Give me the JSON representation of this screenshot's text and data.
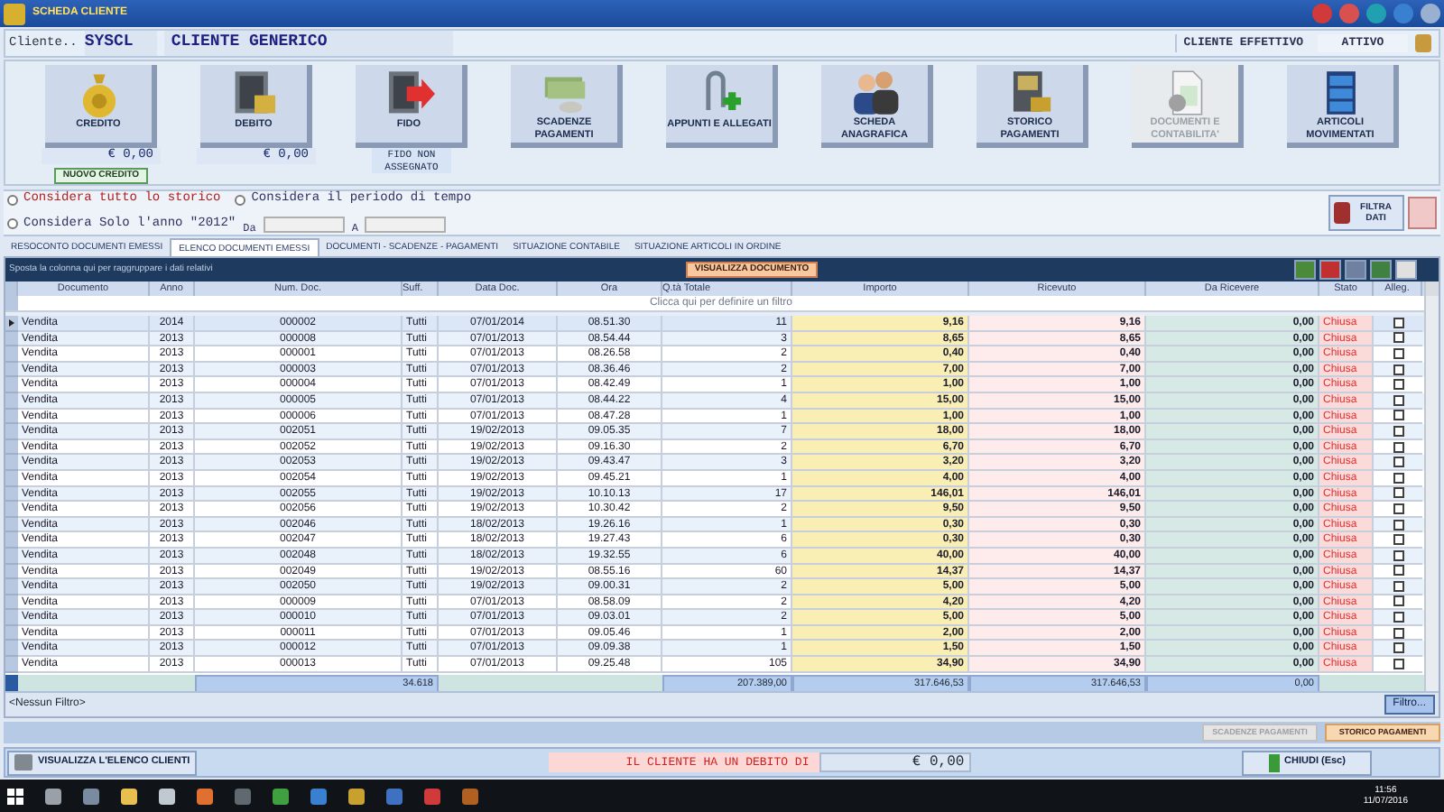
{
  "window": {
    "title": "SCHEDA CLIENTE"
  },
  "client_bar": {
    "label": "Cliente..",
    "code": "SYSCL",
    "name": "CLIENTE GENERICO",
    "type": "CLIENTE EFFETTIVO",
    "status": "ATTIVO"
  },
  "toolbar": [
    {
      "kind": "amount",
      "label": "CREDITO",
      "value": "€ 0,00",
      "badge": "NUOVO CREDITO",
      "disabled": false
    },
    {
      "kind": "amount",
      "label": "DEBITO",
      "value": "€ 0,00",
      "disabled": false
    },
    {
      "kind": "note",
      "label": "FIDO",
      "note": "FIDO NON ASSEGNATO",
      "disabled": false
    },
    {
      "kind": "plain",
      "label": "SCADENZE PAGAMENTI",
      "disabled": false
    },
    {
      "kind": "plain",
      "label": "APPUNTI E ALLEGATI",
      "disabled": false
    },
    {
      "kind": "plain",
      "label": "SCHEDA ANAGRAFICA",
      "disabled": false
    },
    {
      "kind": "plain",
      "label": "STORICO PAGAMENTI",
      "disabled": false
    },
    {
      "kind": "plain",
      "label": "DOCUMENTI E CONTABILITA'",
      "disabled": true
    },
    {
      "kind": "plain",
      "label": "ARTICOLI MOVIMENTATI",
      "disabled": false
    }
  ],
  "period": {
    "options": [
      {
        "label": "Considera tutto lo storico",
        "selected": false
      },
      {
        "label": "Considera il periodo di tempo",
        "selected": false
      },
      {
        "label": "Considera Solo l'anno \"2012\"",
        "selected": false
      }
    ],
    "from_label": "Da",
    "to_label": "A",
    "filter_button": "FILTRA DATI"
  },
  "tabs": [
    {
      "label": "RESOCONTO DOCUMENTI EMESSI",
      "selected": false
    },
    {
      "label": "ELENCO DOCUMENTI EMESSI",
      "selected": true
    },
    {
      "label": "DOCUMENTI - SCADENZE - PAGAMENTI",
      "selected": false
    },
    {
      "label": "SITUAZIONE CONTABILE",
      "selected": false
    },
    {
      "label": "SITUAZIONE ARTICOLI IN ORDINE",
      "selected": false
    }
  ],
  "grid": {
    "group_hint": "Sposta la colonna qui per raggruppare i dati relativi",
    "view_button": "VISUALIZZA DOCUMENTO",
    "columns": [
      "Documento",
      "Anno",
      "Num. Doc.",
      "Suff.",
      "Data Doc.",
      "Ora",
      "Q.tà Totale",
      "Importo",
      "Ricevuto",
      "Da Ricevere",
      "Stato",
      "Alleg."
    ],
    "filter_hint": "Clicca qui per definire un filtro",
    "rows": [
      {
        "documento": "Vendita",
        "anno": "2014",
        "num": "000002",
        "suff": "Tutti",
        "data": "07/01/2014",
        "ora": "08.51.30",
        "qta": "11",
        "importo": "9,16",
        "ricevuto": "9,16",
        "da_ricevere": "0,00",
        "stato": "Chiusa",
        "alleg": false,
        "selected": true
      },
      {
        "documento": "Vendita",
        "anno": "2013",
        "num": "000008",
        "suff": "Tutti",
        "data": "07/01/2013",
        "ora": "08.54.44",
        "qta": "3",
        "importo": "8,65",
        "ricevuto": "8,65",
        "da_ricevere": "0,00",
        "stato": "Chiusa",
        "alleg": false,
        "selected": false
      },
      {
        "documento": "Vendita",
        "anno": "2013",
        "num": "000001",
        "suff": "Tutti",
        "data": "07/01/2013",
        "ora": "08.26.58",
        "qta": "2",
        "importo": "0,40",
        "ricevuto": "0,40",
        "da_ricevere": "0,00",
        "stato": "Chiusa",
        "alleg": false,
        "selected": false
      },
      {
        "documento": "Vendita",
        "anno": "2013",
        "num": "000003",
        "suff": "Tutti",
        "data": "07/01/2013",
        "ora": "08.36.46",
        "qta": "2",
        "importo": "7,00",
        "ricevuto": "7,00",
        "da_ricevere": "0,00",
        "stato": "Chiusa",
        "alleg": false,
        "selected": false
      },
      {
        "documento": "Vendita",
        "anno": "2013",
        "num": "000004",
        "suff": "Tutti",
        "data": "07/01/2013",
        "ora": "08.42.49",
        "qta": "1",
        "importo": "1,00",
        "ricevuto": "1,00",
        "da_ricevere": "0,00",
        "stato": "Chiusa",
        "alleg": false,
        "selected": false
      },
      {
        "documento": "Vendita",
        "anno": "2013",
        "num": "000005",
        "suff": "Tutti",
        "data": "07/01/2013",
        "ora": "08.44.22",
        "qta": "4",
        "importo": "15,00",
        "ricevuto": "15,00",
        "da_ricevere": "0,00",
        "stato": "Chiusa",
        "alleg": false,
        "selected": false
      },
      {
        "documento": "Vendita",
        "anno": "2013",
        "num": "000006",
        "suff": "Tutti",
        "data": "07/01/2013",
        "ora": "08.47.28",
        "qta": "1",
        "importo": "1,00",
        "ricevuto": "1,00",
        "da_ricevere": "0,00",
        "stato": "Chiusa",
        "alleg": false,
        "selected": false
      },
      {
        "documento": "Vendita",
        "anno": "2013",
        "num": "002051",
        "suff": "Tutti",
        "data": "19/02/2013",
        "ora": "09.05.35",
        "qta": "7",
        "importo": "18,00",
        "ricevuto": "18,00",
        "da_ricevere": "0,00",
        "stato": "Chiusa",
        "alleg": false,
        "selected": false
      },
      {
        "documento": "Vendita",
        "anno": "2013",
        "num": "002052",
        "suff": "Tutti",
        "data": "19/02/2013",
        "ora": "09.16.30",
        "qta": "2",
        "importo": "6,70",
        "ricevuto": "6,70",
        "da_ricevere": "0,00",
        "stato": "Chiusa",
        "alleg": false,
        "selected": false
      },
      {
        "documento": "Vendita",
        "anno": "2013",
        "num": "002053",
        "suff": "Tutti",
        "data": "19/02/2013",
        "ora": "09.43.47",
        "qta": "3",
        "importo": "3,20",
        "ricevuto": "3,20",
        "da_ricevere": "0,00",
        "stato": "Chiusa",
        "alleg": false,
        "selected": false
      },
      {
        "documento": "Vendita",
        "anno": "2013",
        "num": "002054",
        "suff": "Tutti",
        "data": "19/02/2013",
        "ora": "09.45.21",
        "qta": "1",
        "importo": "4,00",
        "ricevuto": "4,00",
        "da_ricevere": "0,00",
        "stato": "Chiusa",
        "alleg": false,
        "selected": false
      },
      {
        "documento": "Vendita",
        "anno": "2013",
        "num": "002055",
        "suff": "Tutti",
        "data": "19/02/2013",
        "ora": "10.10.13",
        "qta": "17",
        "importo": "146,01",
        "ricevuto": "146,01",
        "da_ricevere": "0,00",
        "stato": "Chiusa",
        "alleg": false,
        "selected": false
      },
      {
        "documento": "Vendita",
        "anno": "2013",
        "num": "002056",
        "suff": "Tutti",
        "data": "19/02/2013",
        "ora": "10.30.42",
        "qta": "2",
        "importo": "9,50",
        "ricevuto": "9,50",
        "da_ricevere": "0,00",
        "stato": "Chiusa",
        "alleg": false,
        "selected": false
      },
      {
        "documento": "Vendita",
        "anno": "2013",
        "num": "002046",
        "suff": "Tutti",
        "data": "18/02/2013",
        "ora": "19.26.16",
        "qta": "1",
        "importo": "0,30",
        "ricevuto": "0,30",
        "da_ricevere": "0,00",
        "stato": "Chiusa",
        "alleg": false,
        "selected": false
      },
      {
        "documento": "Vendita",
        "anno": "2013",
        "num": "002047",
        "suff": "Tutti",
        "data": "18/02/2013",
        "ora": "19.27.43",
        "qta": "6",
        "importo": "0,30",
        "ricevuto": "0,30",
        "da_ricevere": "0,00",
        "stato": "Chiusa",
        "alleg": false,
        "selected": false
      },
      {
        "documento": "Vendita",
        "anno": "2013",
        "num": "002048",
        "suff": "Tutti",
        "data": "18/02/2013",
        "ora": "19.32.55",
        "qta": "6",
        "importo": "40,00",
        "ricevuto": "40,00",
        "da_ricevere": "0,00",
        "stato": "Chiusa",
        "alleg": false,
        "selected": false
      },
      {
        "documento": "Vendita",
        "anno": "2013",
        "num": "002049",
        "suff": "Tutti",
        "data": "19/02/2013",
        "ora": "08.55.16",
        "qta": "60",
        "importo": "14,37",
        "ricevuto": "14,37",
        "da_ricevere": "0,00",
        "stato": "Chiusa",
        "alleg": false,
        "selected": false
      },
      {
        "documento": "Vendita",
        "anno": "2013",
        "num": "002050",
        "suff": "Tutti",
        "data": "19/02/2013",
        "ora": "09.00.31",
        "qta": "2",
        "importo": "5,00",
        "ricevuto": "5,00",
        "da_ricevere": "0,00",
        "stato": "Chiusa",
        "alleg": false,
        "selected": false
      },
      {
        "documento": "Vendita",
        "anno": "2013",
        "num": "000009",
        "suff": "Tutti",
        "data": "07/01/2013",
        "ora": "08.58.09",
        "qta": "2",
        "importo": "4,20",
        "ricevuto": "4,20",
        "da_ricevere": "0,00",
        "stato": "Chiusa",
        "alleg": false,
        "selected": false
      },
      {
        "documento": "Vendita",
        "anno": "2013",
        "num": "000010",
        "suff": "Tutti",
        "data": "07/01/2013",
        "ora": "09.03.01",
        "qta": "2",
        "importo": "5,00",
        "ricevuto": "5,00",
        "da_ricevere": "0,00",
        "stato": "Chiusa",
        "alleg": false,
        "selected": false
      },
      {
        "documento": "Vendita",
        "anno": "2013",
        "num": "000011",
        "suff": "Tutti",
        "data": "07/01/2013",
        "ora": "09.05.46",
        "qta": "1",
        "importo": "2,00",
        "ricevuto": "2,00",
        "da_ricevere": "0,00",
        "stato": "Chiusa",
        "alleg": false,
        "selected": false
      },
      {
        "documento": "Vendita",
        "anno": "2013",
        "num": "000012",
        "suff": "Tutti",
        "data": "07/01/2013",
        "ora": "09.09.38",
        "qta": "1",
        "importo": "1,50",
        "ricevuto": "1,50",
        "da_ricevere": "0,00",
        "stato": "Chiusa",
        "alleg": false,
        "selected": false
      },
      {
        "documento": "Vendita",
        "anno": "2013",
        "num": "000013",
        "suff": "Tutti",
        "data": "07/01/2013",
        "ora": "09.25.48",
        "qta": "105",
        "importo": "34,90",
        "ricevuto": "34,90",
        "da_ricevere": "0,00",
        "stato": "Chiusa",
        "alleg": false,
        "selected": false
      }
    ],
    "totals": {
      "num": "34.618",
      "qta": "207.389,00",
      "importo": "317.646,53",
      "ricevuto": "317.646,53",
      "da_ricevere": "0,00"
    },
    "filter_status": "<Nessun Filtro>",
    "filter_button": "Filtro..."
  },
  "bottom_tabs": [
    {
      "label": "SCADENZE PAGAMENTI",
      "selected": false
    },
    {
      "label": "STORICO PAGAMENTI",
      "selected": true
    }
  ],
  "footer": {
    "list_button": "VISUALIZZA L'ELENCO CLIENTI",
    "debt_label": "IL CLIENTE HA UN DEBITO DI",
    "debt_value": "€ 0,00",
    "close_button": "CHIUDI (Esc)"
  },
  "taskbar": {
    "time": "11:56",
    "date": "11/07/2016"
  }
}
